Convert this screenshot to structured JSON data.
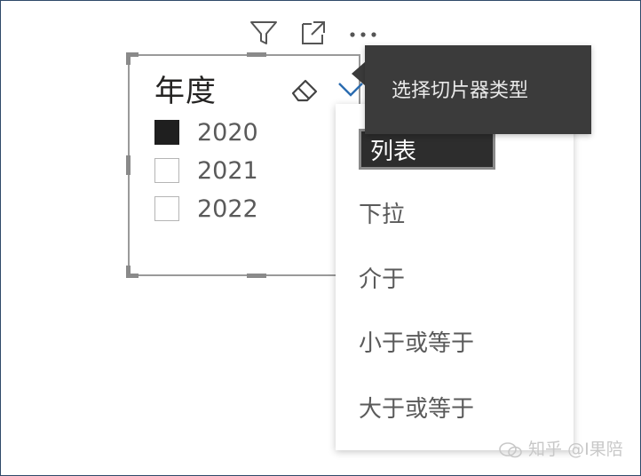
{
  "toolbar": {
    "filter_icon": "filter-icon",
    "focus_icon": "focus-mode-icon",
    "more_icon": "more-options-icon"
  },
  "slicer": {
    "title": "年度",
    "items": [
      {
        "label": "2020",
        "checked": true
      },
      {
        "label": "2021",
        "checked": false
      },
      {
        "label": "2022",
        "checked": false
      }
    ],
    "clear_icon": "eraser-icon",
    "type_icon": "chevron-down-icon"
  },
  "dropdown": {
    "options": [
      {
        "label": "列表",
        "selected": true
      },
      {
        "label": "下拉",
        "selected": false
      },
      {
        "label": "介于",
        "selected": false
      },
      {
        "label": "小于或等于",
        "selected": false
      },
      {
        "label": "大于或等于",
        "selected": false
      }
    ]
  },
  "tooltip": {
    "text": "选择切片器类型"
  },
  "watermark": {
    "text": "知乎 @I果陪"
  },
  "colors": {
    "selected_bg": "#2d2d2d",
    "tooltip_bg": "#3b3b3b",
    "checkbox_checked": "#1f1f1f",
    "frame_border": "#2f4a6a"
  }
}
